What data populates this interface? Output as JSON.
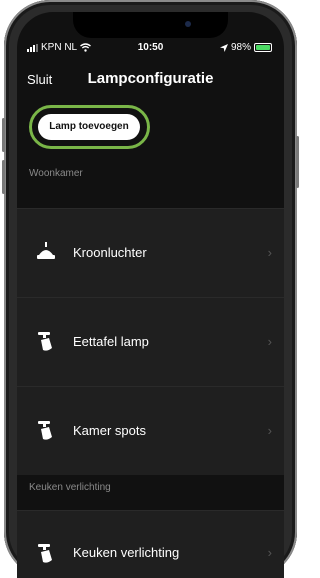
{
  "status_bar": {
    "carrier": "KPN NL",
    "time": "10:50",
    "battery": "98%"
  },
  "nav": {
    "back_label": "Sluit",
    "title": "Lampconfiguratie"
  },
  "actions": {
    "add_lamp_label": "Lamp toevoegen"
  },
  "sections": [
    {
      "title": "Woonkamer",
      "items": [
        {
          "label": "Kroonluchter",
          "icon": "pendant-lamp-icon"
        },
        {
          "label": "Eettafel lamp",
          "icon": "spot-lamp-icon"
        },
        {
          "label": "Kamer spots",
          "icon": "spot-lamp-icon"
        }
      ]
    },
    {
      "title": "Keuken verlichting",
      "items": [
        {
          "label": "Keuken verlichting",
          "icon": "spot-lamp-icon"
        }
      ]
    }
  ],
  "colors": {
    "highlight": "#7ab648",
    "background": "#111111",
    "row": "#1f1f1f"
  }
}
